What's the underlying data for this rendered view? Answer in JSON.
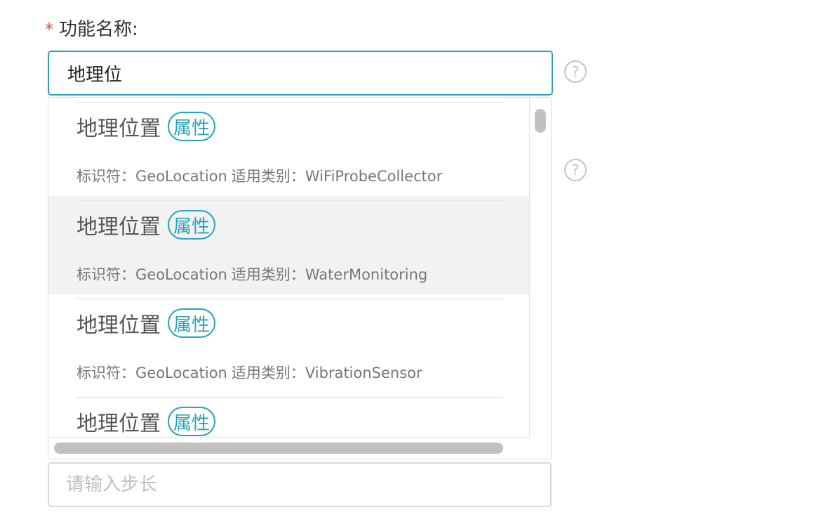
{
  "form": {
    "function_name": {
      "required_mark": "*",
      "label": "功能名称:",
      "value": "地理位"
    },
    "step": {
      "placeholder": "请输入步长"
    }
  },
  "help_icon_glyph": "?",
  "dropdown": {
    "items": [
      {
        "name": "地理位置",
        "tag": "属性",
        "id_label": "标识符：",
        "id_value": "GeoLocation",
        "category_label": "适用类别：",
        "category_value": "WiFiProbeCollector"
      },
      {
        "name": "地理位置",
        "tag": "属性",
        "id_label": "标识符：",
        "id_value": "GeoLocation",
        "category_label": "适用类别：",
        "category_value": "WaterMonitoring"
      },
      {
        "name": "地理位置",
        "tag": "属性",
        "id_label": "标识符：",
        "id_value": "GeoLocation",
        "category_label": "适用类别：",
        "category_value": "VibrationSensor"
      },
      {
        "name": "地理位置",
        "tag": "属性"
      }
    ]
  },
  "colors": {
    "accent": "#2aa3b8",
    "required": "#e0463f",
    "hover_row": "#f2f2f3"
  }
}
